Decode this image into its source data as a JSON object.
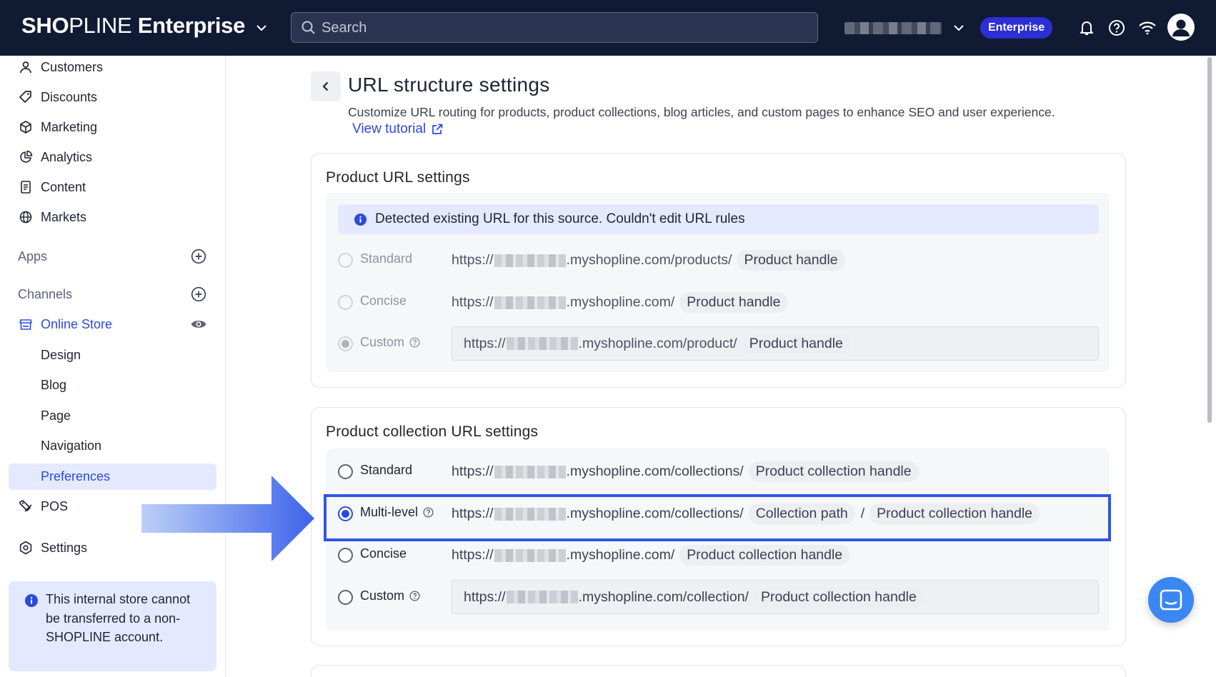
{
  "topbar": {
    "brand_bold": "SH",
    "brand_o": "O",
    "brand_light": "PLINE",
    "brand_suffix": " Enterprise",
    "search_placeholder": "Search",
    "plan_badge": "Enterprise",
    "icons": [
      "chevron-down-icon",
      "search-icon",
      "bell-icon",
      "help-icon",
      "wifi-icon",
      "account-icon"
    ]
  },
  "sidebar": {
    "items": [
      {
        "label": "Customers",
        "icon": "person-icon"
      },
      {
        "label": "Discounts",
        "icon": "tag-icon"
      },
      {
        "label": "Marketing",
        "icon": "cube-icon"
      },
      {
        "label": "Analytics",
        "icon": "pie-chart-icon"
      },
      {
        "label": "Content",
        "icon": "document-icon"
      },
      {
        "label": "Markets",
        "icon": "globe-icon"
      }
    ],
    "apps_label": "Apps",
    "channels_label": "Channels",
    "online_store": "Online Store",
    "sub_items": [
      "Design",
      "Blog",
      "Page",
      "Navigation",
      "Preferences"
    ],
    "active_sub": "Preferences",
    "pos": "POS",
    "settings": "Settings",
    "notice": "This internal store cannot be transferred to a non-SHOPLINE account."
  },
  "page": {
    "title": "URL structure settings",
    "description": "Customize URL routing for products, product collections, blog articles, and custom pages to enhance SEO and user experience.",
    "tutorial": "View tutorial"
  },
  "product_url": {
    "title": "Product URL settings",
    "info": "Detected existing URL for this source. Couldn't edit URL rules",
    "options": [
      {
        "label": "Standard",
        "prefix": "https://",
        "suffix": ".myshopline.com/products/",
        "tag": "Product handle",
        "selected": false
      },
      {
        "label": "Concise",
        "prefix": "https://",
        "suffix": ".myshopline.com/",
        "tag": "Product handle",
        "selected": false
      },
      {
        "label": "Custom",
        "prefix": "https://",
        "suffix": ".myshopline.com/product/",
        "tag": "Product handle",
        "selected": true
      }
    ]
  },
  "collection_url": {
    "title": "Product collection URL settings",
    "options": [
      {
        "label": "Standard",
        "prefix": "https://",
        "suffix": ".myshopline.com/collections/",
        "tag": "Product collection handle",
        "selected": false
      },
      {
        "label": "Multi-level",
        "prefix": "https://",
        "suffix": ".myshopline.com/collections/",
        "tag": "Collection path",
        "separator": "/",
        "tag2": "Product collection handle",
        "selected": true
      },
      {
        "label": "Concise",
        "prefix": "https://",
        "suffix": ".myshopline.com/",
        "tag": "Product collection handle",
        "selected": false
      },
      {
        "label": "Custom",
        "prefix": "https://",
        "suffix": ".myshopline.com/collection/",
        "tag": "Product collection handle",
        "selected": false
      }
    ]
  },
  "colors": {
    "topbar": "#101a33",
    "accent": "#2c4bdc",
    "highlight_border": "#2f55e6",
    "info_bg": "#e5e9ff"
  }
}
